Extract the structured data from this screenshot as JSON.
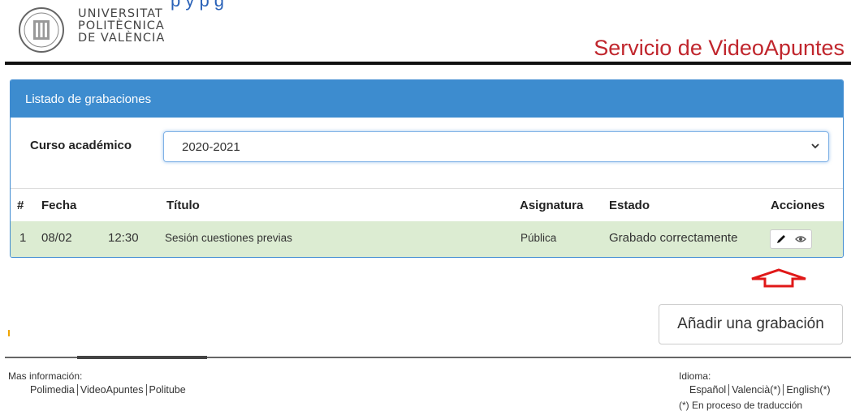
{
  "header": {
    "top_partial_text": "p                                          y p         g",
    "logo_lines": [
      "UNIVERSITAT",
      "POLITÈCNICA",
      "DE VALÈNCIA"
    ],
    "service_title": "Servicio de VideoApuntes"
  },
  "panel": {
    "title": "Listado de grabaciones",
    "course_label": "Curso académico",
    "course_value": "2020-2021",
    "columns": [
      "#",
      "Fecha",
      "Título",
      "Asignatura",
      "Estado",
      "Acciones"
    ],
    "rows": [
      {
        "num": "1",
        "date": "08/02",
        "time": "12:30",
        "title": "Sesión cuestiones previas",
        "subject": "Pública",
        "status": "Grabado correctamente"
      }
    ]
  },
  "add_button": "Añadir una grabación",
  "footer": {
    "more_info_label": "Mas información:",
    "more_info_links": [
      "Polimedia",
      "VideoApuntes",
      "Politube"
    ],
    "language_label": "Idioma:",
    "languages": [
      "Español",
      "Valencià(*)",
      "English(*)"
    ],
    "note": "(*) En proceso de traducción"
  },
  "colors": {
    "accent": "#3d8ccf",
    "brand_red": "#c0262d",
    "row_green": "#dcecd2",
    "arrow_red": "#e01818"
  }
}
